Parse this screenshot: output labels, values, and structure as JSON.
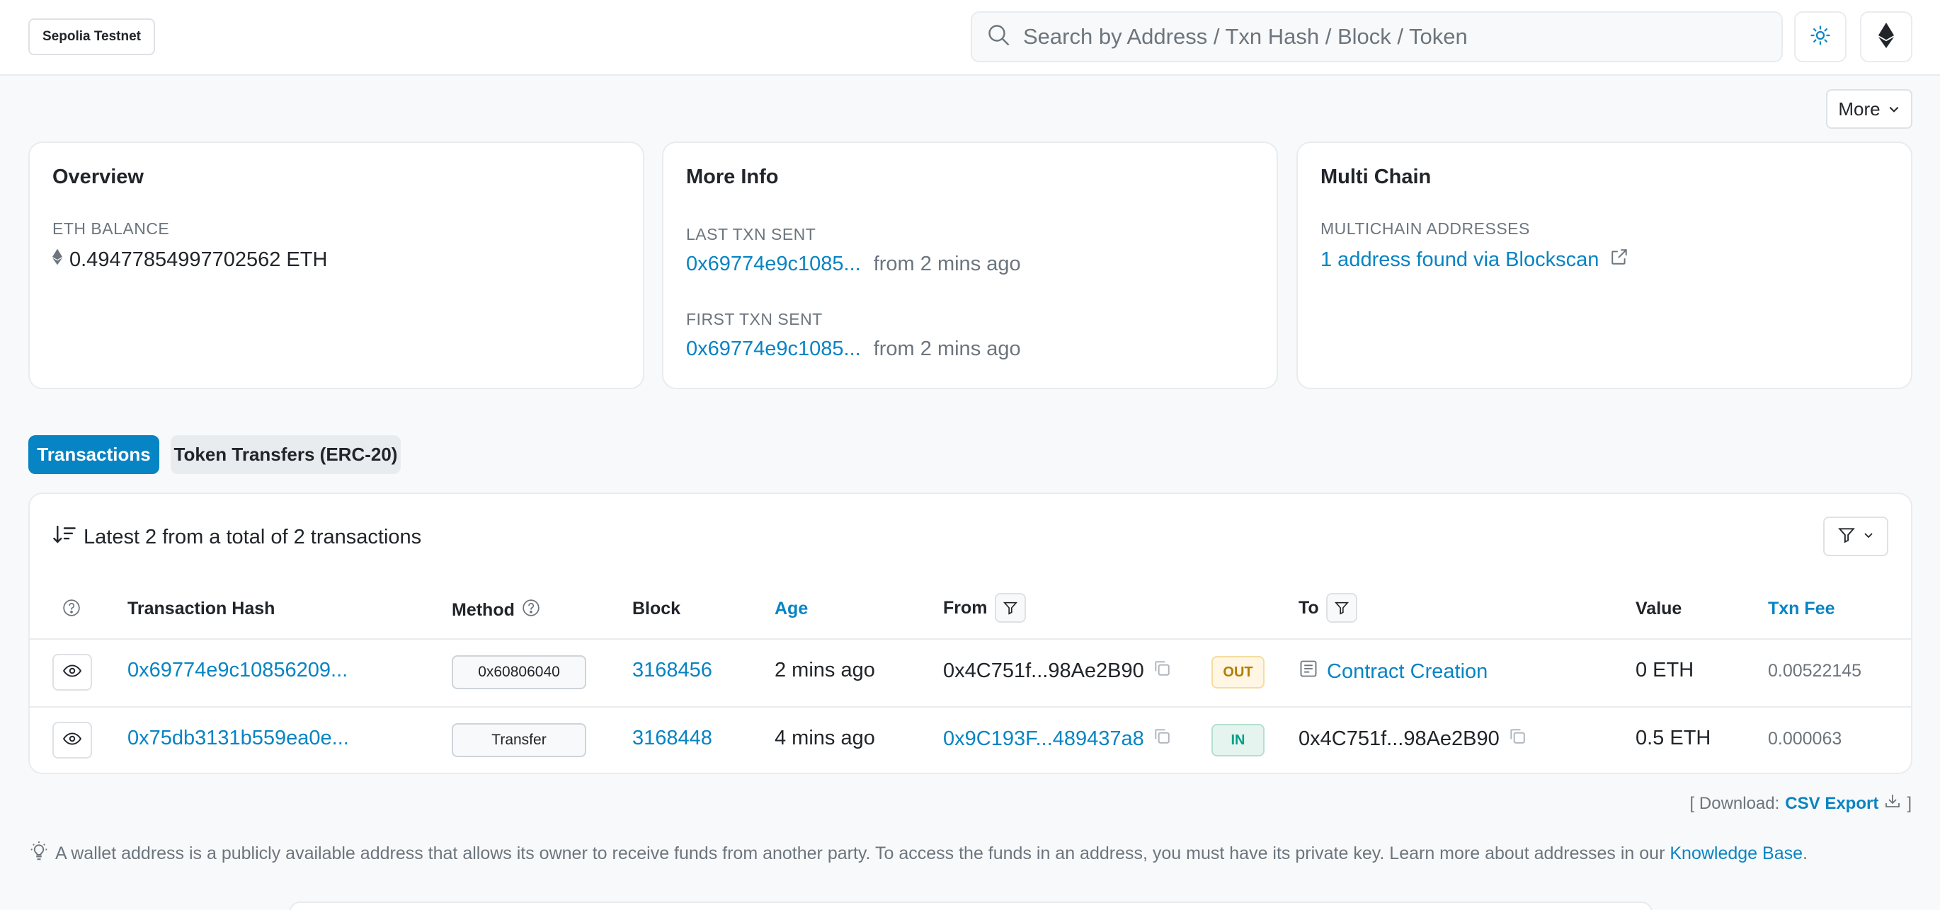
{
  "header": {
    "network": "Sepolia Testnet",
    "search_placeholder": "Search by Address / Txn Hash / Block / Token"
  },
  "toolbar": {
    "more_label": "More"
  },
  "overview": {
    "title": "Overview",
    "balance_label": "ETH BALANCE",
    "balance_value": "0.49477854997702562 ETH"
  },
  "more_info": {
    "title": "More Info",
    "last_label": "LAST TXN SENT",
    "last_hash": "0x69774e9c1085...",
    "last_time": "from 2 mins ago",
    "first_label": "FIRST TXN SENT",
    "first_hash": "0x69774e9c1085...",
    "first_time": "from 2 mins ago"
  },
  "multi_chain": {
    "title": "Multi Chain",
    "label": "MULTICHAIN ADDRESSES",
    "link": "1 address found via Blockscan"
  },
  "tabs": [
    {
      "label": "Transactions",
      "active": true
    },
    {
      "label": "Token Transfers (ERC-20)",
      "active": false
    }
  ],
  "transactions": {
    "summary": "Latest 2 from a total of 2 transactions",
    "columns": {
      "hash": "Transaction Hash",
      "method": "Method",
      "block": "Block",
      "age": "Age",
      "from": "From",
      "to": "To",
      "value": "Value",
      "fee": "Txn Fee"
    },
    "rows": [
      {
        "hash": "0x69774e9c10856209...",
        "method": "0x60806040",
        "block": "3168456",
        "age": "2 mins ago",
        "from": "0x4C751f...98Ae2B90",
        "direction": "OUT",
        "to": "Contract Creation",
        "value": "0 ETH",
        "fee": "0.00522145"
      },
      {
        "hash": "0x75db3131b559ea0e...",
        "method": "Transfer",
        "block": "3168448",
        "age": "4 mins ago",
        "from": "0x9C193F...489437a8",
        "direction": "IN",
        "to": "0x4C751f...98Ae2B90",
        "value": "0.5 ETH",
        "fee": "0.000063"
      }
    ]
  },
  "download": {
    "prefix": "[ Download:",
    "link": "CSV Export",
    "suffix": "]"
  },
  "note": {
    "text": "A wallet address is a publicly available address that allows its owner to receive funds from another party. To access the funds in an address, you must have its private key. Learn more about addresses in our",
    "link": "Knowledge Base",
    "end": "."
  },
  "colors": {
    "accent": "#0784c3",
    "out_badge": "#b47d00",
    "in_badge": "#00a186"
  }
}
